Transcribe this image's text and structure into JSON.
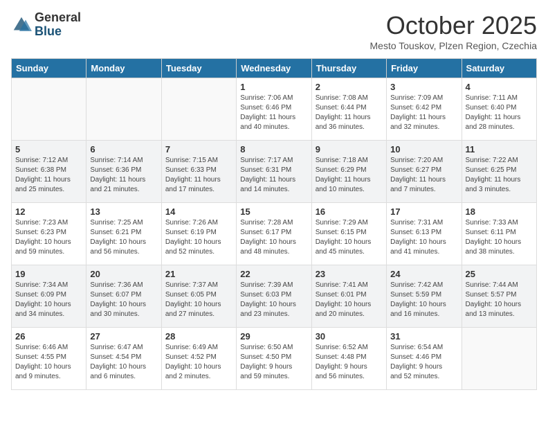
{
  "logo": {
    "general": "General",
    "blue": "Blue"
  },
  "title": "October 2025",
  "subtitle": "Mesto Touskov, Plzen Region, Czechia",
  "weekdays": [
    "Sunday",
    "Monday",
    "Tuesday",
    "Wednesday",
    "Thursday",
    "Friday",
    "Saturday"
  ],
  "weeks": [
    [
      {
        "day": "",
        "info": ""
      },
      {
        "day": "",
        "info": ""
      },
      {
        "day": "",
        "info": ""
      },
      {
        "day": "1",
        "info": "Sunrise: 7:06 AM\nSunset: 6:46 PM\nDaylight: 11 hours\nand 40 minutes."
      },
      {
        "day": "2",
        "info": "Sunrise: 7:08 AM\nSunset: 6:44 PM\nDaylight: 11 hours\nand 36 minutes."
      },
      {
        "day": "3",
        "info": "Sunrise: 7:09 AM\nSunset: 6:42 PM\nDaylight: 11 hours\nand 32 minutes."
      },
      {
        "day": "4",
        "info": "Sunrise: 7:11 AM\nSunset: 6:40 PM\nDaylight: 11 hours\nand 28 minutes."
      }
    ],
    [
      {
        "day": "5",
        "info": "Sunrise: 7:12 AM\nSunset: 6:38 PM\nDaylight: 11 hours\nand 25 minutes."
      },
      {
        "day": "6",
        "info": "Sunrise: 7:14 AM\nSunset: 6:36 PM\nDaylight: 11 hours\nand 21 minutes."
      },
      {
        "day": "7",
        "info": "Sunrise: 7:15 AM\nSunset: 6:33 PM\nDaylight: 11 hours\nand 17 minutes."
      },
      {
        "day": "8",
        "info": "Sunrise: 7:17 AM\nSunset: 6:31 PM\nDaylight: 11 hours\nand 14 minutes."
      },
      {
        "day": "9",
        "info": "Sunrise: 7:18 AM\nSunset: 6:29 PM\nDaylight: 11 hours\nand 10 minutes."
      },
      {
        "day": "10",
        "info": "Sunrise: 7:20 AM\nSunset: 6:27 PM\nDaylight: 11 hours\nand 7 minutes."
      },
      {
        "day": "11",
        "info": "Sunrise: 7:22 AM\nSunset: 6:25 PM\nDaylight: 11 hours\nand 3 minutes."
      }
    ],
    [
      {
        "day": "12",
        "info": "Sunrise: 7:23 AM\nSunset: 6:23 PM\nDaylight: 10 hours\nand 59 minutes."
      },
      {
        "day": "13",
        "info": "Sunrise: 7:25 AM\nSunset: 6:21 PM\nDaylight: 10 hours\nand 56 minutes."
      },
      {
        "day": "14",
        "info": "Sunrise: 7:26 AM\nSunset: 6:19 PM\nDaylight: 10 hours\nand 52 minutes."
      },
      {
        "day": "15",
        "info": "Sunrise: 7:28 AM\nSunset: 6:17 PM\nDaylight: 10 hours\nand 48 minutes."
      },
      {
        "day": "16",
        "info": "Sunrise: 7:29 AM\nSunset: 6:15 PM\nDaylight: 10 hours\nand 45 minutes."
      },
      {
        "day": "17",
        "info": "Sunrise: 7:31 AM\nSunset: 6:13 PM\nDaylight: 10 hours\nand 41 minutes."
      },
      {
        "day": "18",
        "info": "Sunrise: 7:33 AM\nSunset: 6:11 PM\nDaylight: 10 hours\nand 38 minutes."
      }
    ],
    [
      {
        "day": "19",
        "info": "Sunrise: 7:34 AM\nSunset: 6:09 PM\nDaylight: 10 hours\nand 34 minutes."
      },
      {
        "day": "20",
        "info": "Sunrise: 7:36 AM\nSunset: 6:07 PM\nDaylight: 10 hours\nand 30 minutes."
      },
      {
        "day": "21",
        "info": "Sunrise: 7:37 AM\nSunset: 6:05 PM\nDaylight: 10 hours\nand 27 minutes."
      },
      {
        "day": "22",
        "info": "Sunrise: 7:39 AM\nSunset: 6:03 PM\nDaylight: 10 hours\nand 23 minutes."
      },
      {
        "day": "23",
        "info": "Sunrise: 7:41 AM\nSunset: 6:01 PM\nDaylight: 10 hours\nand 20 minutes."
      },
      {
        "day": "24",
        "info": "Sunrise: 7:42 AM\nSunset: 5:59 PM\nDaylight: 10 hours\nand 16 minutes."
      },
      {
        "day": "25",
        "info": "Sunrise: 7:44 AM\nSunset: 5:57 PM\nDaylight: 10 hours\nand 13 minutes."
      }
    ],
    [
      {
        "day": "26",
        "info": "Sunrise: 6:46 AM\nSunset: 4:55 PM\nDaylight: 10 hours\nand 9 minutes."
      },
      {
        "day": "27",
        "info": "Sunrise: 6:47 AM\nSunset: 4:54 PM\nDaylight: 10 hours\nand 6 minutes."
      },
      {
        "day": "28",
        "info": "Sunrise: 6:49 AM\nSunset: 4:52 PM\nDaylight: 10 hours\nand 2 minutes."
      },
      {
        "day": "29",
        "info": "Sunrise: 6:50 AM\nSunset: 4:50 PM\nDaylight: 9 hours\nand 59 minutes."
      },
      {
        "day": "30",
        "info": "Sunrise: 6:52 AM\nSunset: 4:48 PM\nDaylight: 9 hours\nand 56 minutes."
      },
      {
        "day": "31",
        "info": "Sunrise: 6:54 AM\nSunset: 4:46 PM\nDaylight: 9 hours\nand 52 minutes."
      },
      {
        "day": "",
        "info": ""
      }
    ]
  ]
}
